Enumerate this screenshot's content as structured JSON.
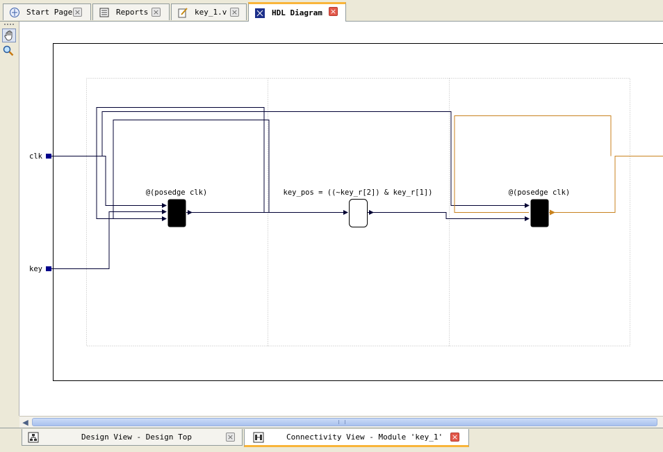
{
  "tabs": [
    {
      "label": "Start Page",
      "icon": "start-page-icon",
      "active": false
    },
    {
      "label": "Reports",
      "icon": "reports-icon",
      "active": false
    },
    {
      "label": "key_1.v",
      "icon": "verilog-file-icon",
      "active": false
    },
    {
      "label": "HDL Diagram",
      "icon": "hdl-diagram-icon",
      "active": true
    }
  ],
  "toolbar": {
    "tools": [
      {
        "name": "pan-hand-icon",
        "selected": true
      },
      {
        "name": "zoom-magnifier-icon",
        "selected": false
      }
    ]
  },
  "diagram": {
    "ports": {
      "clk": "clk",
      "key": "key"
    },
    "block1_label": "@(posedge clk)",
    "block2_label": "key_pos = ((~key_r[2]) & key_r[1])",
    "block3_label": "@(posedge clk)",
    "colors": {
      "wire": "#000033",
      "highlight": "#c8821e",
      "port": "#00008b",
      "block": "#000000"
    }
  },
  "bottom_tabs": [
    {
      "label": "Design View - Design Top",
      "icon": "design-view-icon",
      "active": false
    },
    {
      "label": "Connectivity View - Module 'key_1'",
      "icon": "connectivity-view-icon",
      "active": true
    }
  ]
}
